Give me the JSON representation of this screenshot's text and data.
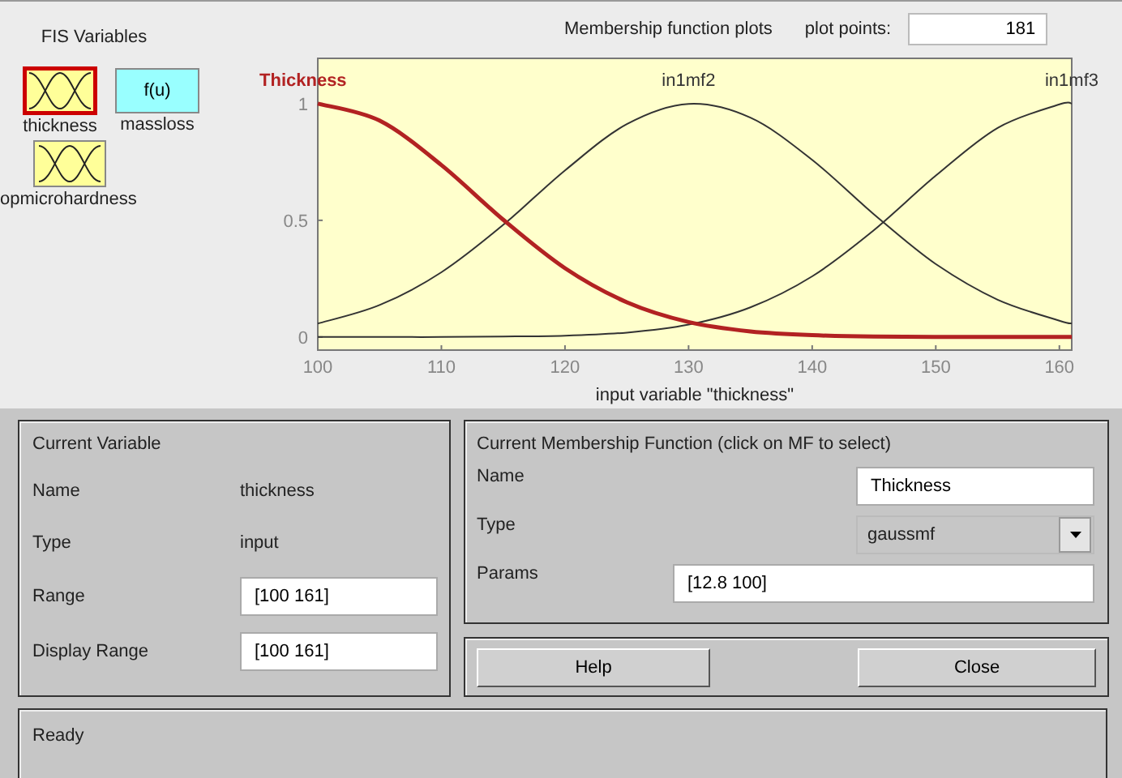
{
  "fis_variables": {
    "title": "FIS Variables",
    "variables": [
      {
        "label": "thickness",
        "kind": "mf",
        "selected": true
      },
      {
        "label": "massloss",
        "kind": "function",
        "icon_text": "f(u)",
        "selected": false
      },
      {
        "label": "opmicrohardness",
        "kind": "mf",
        "selected": false
      }
    ]
  },
  "plot": {
    "title": "Membership function plots",
    "points_label": "plot points:",
    "points": "181",
    "curves": [
      {
        "selected": true
      },
      {
        "selected": false
      },
      {
        "selected": false
      }
    ],
    "chart_data": {
      "type": "line",
      "xlabel": "input variable \"thickness\"",
      "x": [
        100,
        105,
        110,
        115,
        120,
        125,
        130,
        135,
        140,
        145,
        150,
        155,
        160,
        161
      ],
      "xlim": [
        100,
        161
      ],
      "ylim": [
        -0.056,
        1.194
      ],
      "xticks": [
        100,
        110,
        120,
        130,
        140,
        150,
        160
      ],
      "yticks": [
        0,
        0.5,
        1
      ],
      "series": [
        {
          "name": "Thickness",
          "color": "#b22222",
          "values": [
            1,
            0.927,
            0.737,
            0.503,
            0.295,
            0.149,
            0.064,
            0.024,
            0.008,
            0.002,
            0,
            0,
            0,
            0
          ]
        },
        {
          "name": "in1mf2",
          "color": "#333333",
          "values": [
            0.058,
            0.137,
            0.277,
            0.48,
            0.714,
            0.912,
            0.999,
            0.94,
            0.759,
            0.526,
            0.313,
            0.16,
            0.07,
            0.058
          ]
        },
        {
          "name": "in1mf3",
          "color": "#333333",
          "values": [
            0,
            0,
            0,
            0.002,
            0.006,
            0.019,
            0.053,
            0.127,
            0.26,
            0.458,
            0.691,
            0.896,
            0.997,
            1
          ]
        }
      ]
    }
  },
  "current_variable": {
    "title": "Current Variable",
    "rows": [
      {
        "label": "Name",
        "value": "thickness",
        "kind": "text"
      },
      {
        "label": "Type",
        "value": "input",
        "kind": "text"
      },
      {
        "label": "Range",
        "value": "[100 161]",
        "kind": "field"
      },
      {
        "label": "Display Range",
        "value": "[100 161]",
        "kind": "field"
      }
    ]
  },
  "current_mf": {
    "title": "Current Membership Function (click on MF to select)",
    "name_label": "Name",
    "name": "Thickness",
    "type_label": "Type",
    "type": "gaussmf",
    "params_label": "Params",
    "params": "[12.8 100]"
  },
  "buttons": [
    "Help",
    "Close"
  ],
  "status": "Ready"
}
